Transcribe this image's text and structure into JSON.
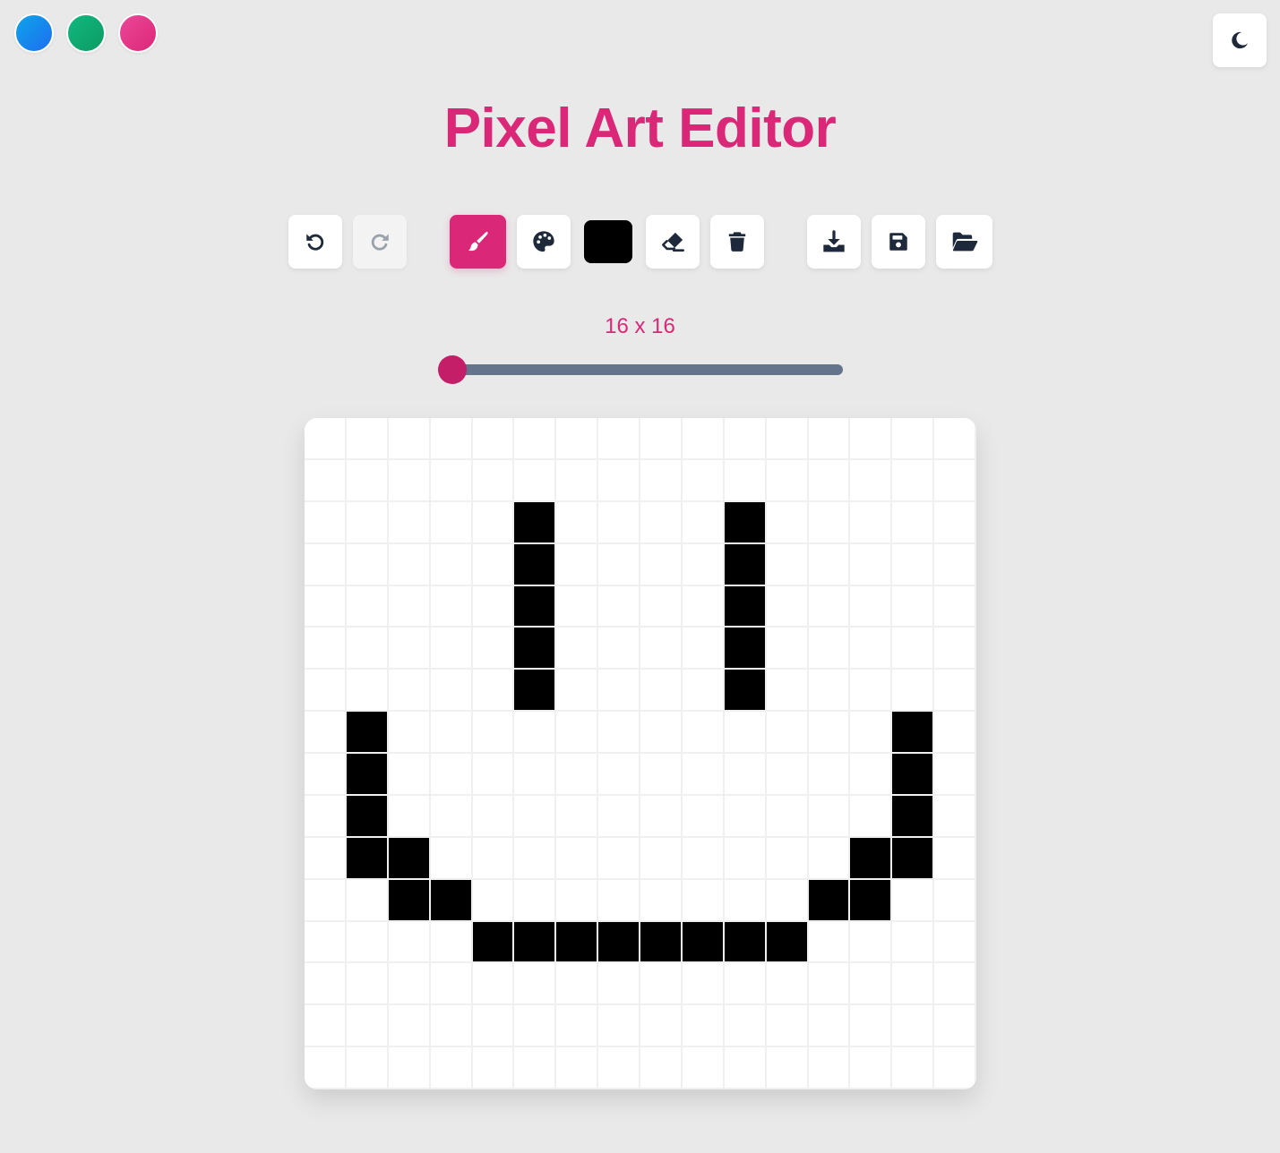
{
  "app": {
    "title": "Pixel Art Editor"
  },
  "colors": {
    "background": "#e9e9e9",
    "accent": "#db2777",
    "accent_dark": "#c41e68",
    "icon": "#1e293b",
    "icon_disabled": "#9aa3ad",
    "track": "#64748b",
    "grid_line": "#f0f0f0",
    "pixel_off": "#ffffff",
    "pixel_on": "#000000"
  },
  "theme_dots": [
    {
      "name": "blue",
      "gradient": [
        "#0ea5e9",
        "#1e6df0"
      ]
    },
    {
      "name": "green",
      "gradient": [
        "#10b981",
        "#0e9a63"
      ]
    },
    {
      "name": "pink",
      "gradient": [
        "#ec4899",
        "#db2777"
      ]
    }
  ],
  "dark_mode_toggle": {
    "icon": "moon-icon"
  },
  "toolbar": {
    "undo": {
      "icon": "undo-icon",
      "enabled": true
    },
    "redo": {
      "icon": "redo-icon",
      "enabled": false
    },
    "brush": {
      "icon": "paintbrush-icon",
      "active": true
    },
    "palette": {
      "icon": "palette-icon"
    },
    "current_color": "#000000",
    "eraser": {
      "icon": "eraser-icon"
    },
    "clear": {
      "icon": "trash-icon"
    },
    "download": {
      "icon": "download-icon"
    },
    "save": {
      "icon": "floppy-disk-icon"
    },
    "open": {
      "icon": "folder-open-icon"
    }
  },
  "grid_size": {
    "label": "16 x 16",
    "value": 16
  },
  "canvas": {
    "rows": [
      "0000000000000000",
      "0000000000000000",
      "0000010000100000",
      "0000010000100000",
      "0000010000100000",
      "0000010000100000",
      "0000010000100000",
      "0100000000000010",
      "0100000000000010",
      "0100000000000010",
      "0110000000000110",
      "0011000000001100",
      "0000111111110000",
      "0000000000000000",
      "0000000000000000",
      "0000000000000000"
    ]
  }
}
